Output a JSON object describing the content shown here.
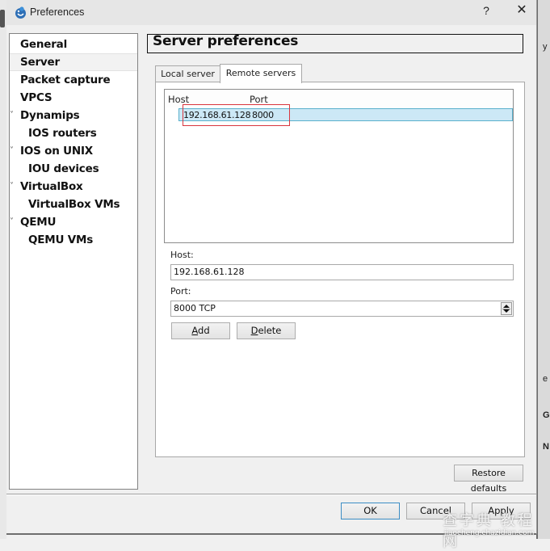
{
  "window": {
    "title": "Preferences",
    "help_label": "?",
    "close_label": "✕"
  },
  "sidebar": {
    "items": [
      {
        "label": "General",
        "level": 0,
        "expandable": false,
        "selected": false
      },
      {
        "label": "Server",
        "level": 0,
        "expandable": false,
        "selected": true
      },
      {
        "label": "Packet capture",
        "level": 0,
        "expandable": false,
        "selected": false
      },
      {
        "label": "VPCS",
        "level": 0,
        "expandable": false,
        "selected": false
      },
      {
        "label": "Dynamips",
        "level": 0,
        "expandable": true,
        "selected": false
      },
      {
        "label": "IOS routers",
        "level": 1,
        "expandable": false,
        "selected": false
      },
      {
        "label": "IOS on UNIX",
        "level": 0,
        "expandable": true,
        "selected": false
      },
      {
        "label": "IOU devices",
        "level": 1,
        "expandable": false,
        "selected": false
      },
      {
        "label": "VirtualBox",
        "level": 0,
        "expandable": true,
        "selected": false
      },
      {
        "label": "VirtualBox VMs",
        "level": 1,
        "expandable": false,
        "selected": false
      },
      {
        "label": "QEMU",
        "level": 0,
        "expandable": true,
        "selected": false
      },
      {
        "label": "QEMU VMs",
        "level": 1,
        "expandable": false,
        "selected": false
      }
    ],
    "chevron_glyph": "˅"
  },
  "main": {
    "title": "Server preferences",
    "tabs": [
      {
        "label": "Local server",
        "active": false
      },
      {
        "label": "Remote servers",
        "active": true
      }
    ],
    "server_list": {
      "columns": [
        "Host",
        "Port"
      ],
      "rows": [
        {
          "host": "192.168.61.128",
          "port": "8000",
          "selected": true
        }
      ]
    },
    "host_label": "Host:",
    "host_value": "192.168.61.128",
    "port_label": "Port:",
    "port_value": "8000 TCP",
    "add_label": "Add",
    "add_mnemonic": "A",
    "add_rest": "dd",
    "delete_label": "Delete",
    "delete_mnemonic": "D",
    "delete_rest": "elete",
    "restore_label": "Restore defaults"
  },
  "footer": {
    "ok_label": "OK",
    "cancel_label": "Cancel",
    "apply_label": "Apply"
  },
  "colors": {
    "selection": "#cce8f6",
    "selection_border": "#5ab0cc",
    "annotation": "#d9363e",
    "default_button_border": "#3c8dc4"
  },
  "watermark": {
    "text": "查字典 教程网",
    "url": "jiaocheng.chazidian.com"
  }
}
